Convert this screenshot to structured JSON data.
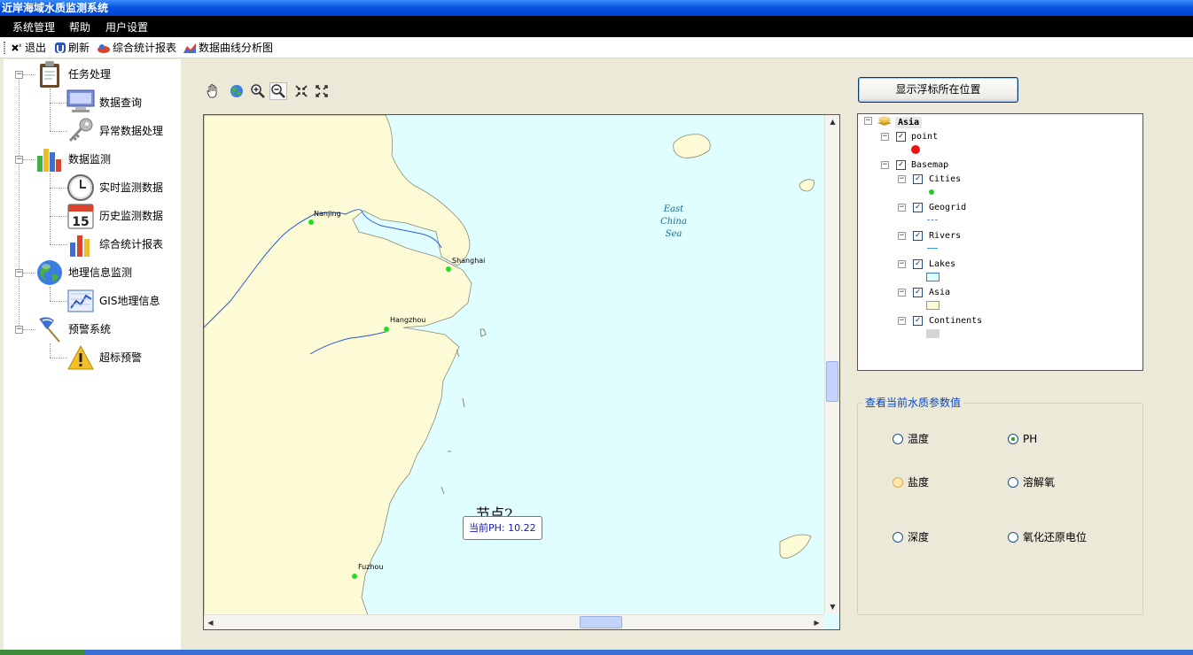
{
  "window": {
    "title": "近岸海域水质监测系统"
  },
  "menu": [
    "系统管理",
    "帮助",
    "用户设置"
  ],
  "toolbar": {
    "exit": "退出",
    "refresh": "刷新",
    "report": "综合统计报表",
    "curve": "数据曲线分析图"
  },
  "tree": {
    "g1": {
      "label": "任务处理",
      "items": [
        "数据查询",
        "异常数据处理"
      ]
    },
    "g2": {
      "label": "数据监测",
      "items": [
        "实时监测数据",
        "历史监测数据",
        "综合统计报表"
      ]
    },
    "g3": {
      "label": "地理信息监测",
      "items": [
        "GIS地理信息"
      ]
    },
    "g4": {
      "label": "预警系统",
      "items": [
        "超标预警"
      ]
    }
  },
  "map": {
    "sea_label": [
      "East",
      "China",
      "Sea"
    ],
    "cities": [
      "Nanjing",
      "Shanghai",
      "Hangzhou",
      "Fuzhou"
    ],
    "node_title": "节点2",
    "node_tooltip": "当前PH: 10.22"
  },
  "show_button": "显示浮标所在位置",
  "legend": {
    "root": "Asia",
    "point": "point",
    "basemap": "Basemap",
    "layers": [
      "Cities",
      "Geogrid",
      "Rivers",
      "Lakes",
      "Asia",
      "Continents"
    ]
  },
  "params": {
    "title": "查看当前水质参数值",
    "options": [
      "温度",
      "PH",
      "盐度",
      "溶解氧",
      "深度",
      "氧化还原电位"
    ],
    "selected": "PH"
  },
  "colors": {
    "land": "#fdfbd6",
    "sea": "#e0feff",
    "river": "#2b5bd8",
    "city": "#22dd22",
    "point": "#ee1111",
    "title": "#0046d5"
  }
}
